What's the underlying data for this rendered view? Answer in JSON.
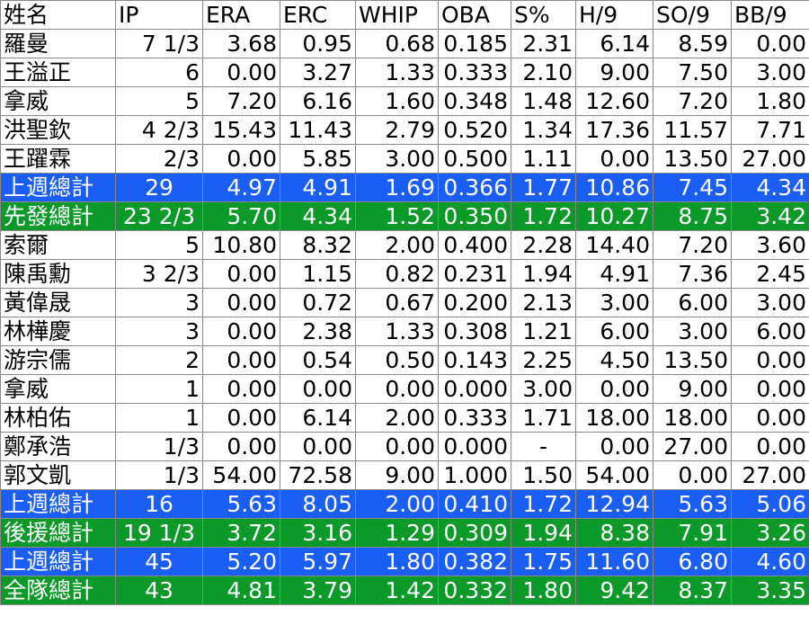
{
  "headers": [
    "姓名",
    "IP",
    "ERA",
    "ERC",
    "WHIP",
    "OBA",
    "S%",
    "H/9",
    "SO/9",
    "BB/9"
  ],
  "colors": {
    "blue_total": "#1a5ef5",
    "green_total": "#0b9a2a",
    "grid": "#8a8a8a"
  },
  "rows": [
    {
      "type": "player",
      "cells": [
        "羅曼",
        "7 1/3",
        "3.68",
        "0.95",
        "0.68",
        "0.185",
        "2.31",
        "6.14",
        "8.59",
        "0.00"
      ]
    },
    {
      "type": "player",
      "cells": [
        "王溢正",
        "6",
        "0.00",
        "3.27",
        "1.33",
        "0.333",
        "2.10",
        "9.00",
        "7.50",
        "3.00"
      ]
    },
    {
      "type": "player",
      "cells": [
        "拿威",
        "5",
        "7.20",
        "6.16",
        "1.60",
        "0.348",
        "1.48",
        "12.60",
        "7.20",
        "1.80"
      ]
    },
    {
      "type": "player",
      "cells": [
        "洪聖欽",
        "4 2/3",
        "15.43",
        "11.43",
        "2.79",
        "0.520",
        "1.34",
        "17.36",
        "11.57",
        "7.71"
      ]
    },
    {
      "type": "player",
      "cells": [
        "王躍霖",
        "2/3",
        "0.00",
        "5.85",
        "3.00",
        "0.500",
        "1.11",
        "0.00",
        "13.50",
        "27.00"
      ]
    },
    {
      "type": "blue",
      "cells": [
        "上週總計",
        "29",
        "4.97",
        "4.91",
        "1.69",
        "0.366",
        "1.77",
        "10.86",
        "7.45",
        "4.34"
      ]
    },
    {
      "type": "green",
      "cells": [
        "先發總計",
        "23 2/3",
        "5.70",
        "4.34",
        "1.52",
        "0.350",
        "1.72",
        "10.27",
        "8.75",
        "3.42"
      ]
    },
    {
      "type": "player",
      "cells": [
        "索爾",
        "5",
        "10.80",
        "8.32",
        "2.00",
        "0.400",
        "2.28",
        "14.40",
        "7.20",
        "3.60"
      ]
    },
    {
      "type": "player",
      "cells": [
        "陳禹勳",
        "3 2/3",
        "0.00",
        "1.15",
        "0.82",
        "0.231",
        "1.94",
        "4.91",
        "7.36",
        "2.45"
      ]
    },
    {
      "type": "player",
      "cells": [
        "黃偉晟",
        "3",
        "0.00",
        "0.72",
        "0.67",
        "0.200",
        "2.13",
        "3.00",
        "6.00",
        "3.00"
      ]
    },
    {
      "type": "player",
      "cells": [
        "林樺慶",
        "3",
        "0.00",
        "2.38",
        "1.33",
        "0.308",
        "1.21",
        "6.00",
        "3.00",
        "6.00"
      ]
    },
    {
      "type": "player",
      "cells": [
        "游宗儒",
        "2",
        "0.00",
        "0.54",
        "0.50",
        "0.143",
        "2.25",
        "4.50",
        "13.50",
        "0.00"
      ]
    },
    {
      "type": "player",
      "cells": [
        "拿威",
        "1",
        "0.00",
        "0.00",
        "0.00",
        "0.000",
        "3.00",
        "0.00",
        "9.00",
        "0.00"
      ]
    },
    {
      "type": "player",
      "cells": [
        "林柏佑",
        "1",
        "0.00",
        "6.14",
        "2.00",
        "0.333",
        "1.71",
        "18.00",
        "18.00",
        "0.00"
      ]
    },
    {
      "type": "player",
      "cells": [
        "鄭承浩",
        "1/3",
        "0.00",
        "0.00",
        "0.00",
        "0.000",
        "-",
        "0.00",
        "27.00",
        "0.00"
      ]
    },
    {
      "type": "player",
      "cells": [
        "郭文凱",
        "1/3",
        "54.00",
        "72.58",
        "9.00",
        "1.000",
        "1.50",
        "54.00",
        "0.00",
        "27.00"
      ]
    },
    {
      "type": "blue",
      "cells": [
        "上週總計",
        "16",
        "5.63",
        "8.05",
        "2.00",
        "0.410",
        "1.72",
        "12.94",
        "5.63",
        "5.06"
      ]
    },
    {
      "type": "green",
      "cells": [
        "後援總計",
        "19 1/3",
        "3.72",
        "3.16",
        "1.29",
        "0.309",
        "1.94",
        "8.38",
        "7.91",
        "3.26"
      ]
    },
    {
      "type": "blue",
      "cells": [
        "上週總計",
        "45",
        "5.20",
        "5.97",
        "1.80",
        "0.382",
        "1.75",
        "11.60",
        "6.80",
        "4.60"
      ]
    },
    {
      "type": "green",
      "cells": [
        "全隊總計",
        "43",
        "4.81",
        "3.79",
        "1.42",
        "0.332",
        "1.80",
        "9.42",
        "8.37",
        "3.35"
      ]
    }
  ]
}
